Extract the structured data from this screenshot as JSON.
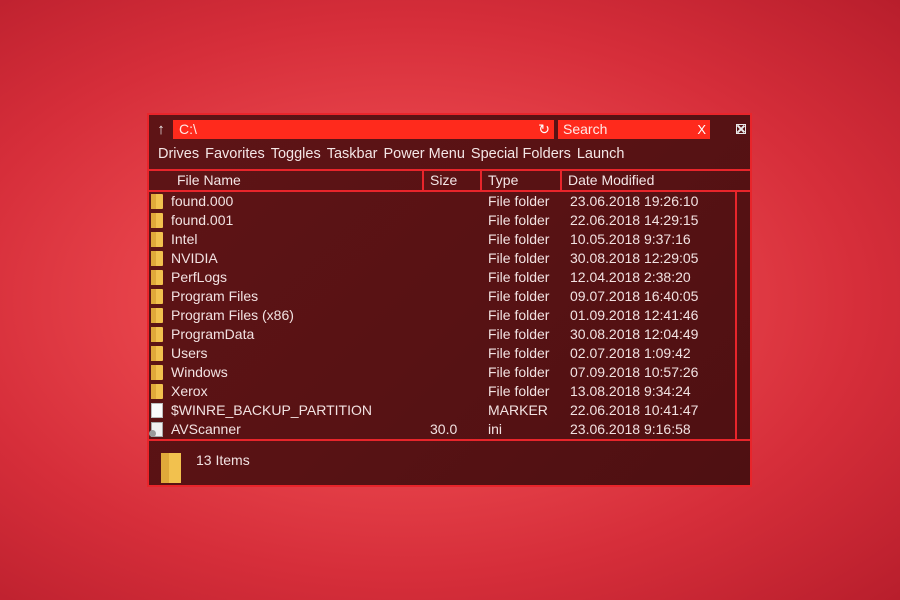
{
  "toolbar": {
    "up_icon": "arrow-up-icon",
    "address_value": "C:\\",
    "refresh_icon": "refresh-icon",
    "search_value": "Search",
    "search_clear": "X",
    "close_icon": "close-box-icon"
  },
  "menu": {
    "items": [
      "Drives",
      "Favorites",
      "Toggles",
      "Taskbar",
      "Power Menu",
      "Special Folders",
      "Launch"
    ]
  },
  "columns": {
    "name": "File Name",
    "size": "Size",
    "type": "Type",
    "date": "Date Modified"
  },
  "files": [
    {
      "icon": "folder-icon",
      "name": "found.000",
      "size": "",
      "type": "File folder",
      "date": "23.06.2018 19:26:10"
    },
    {
      "icon": "folder-icon",
      "name": "found.001",
      "size": "",
      "type": "File folder",
      "date": "22.06.2018 14:29:15"
    },
    {
      "icon": "folder-icon",
      "name": "Intel",
      "size": "",
      "type": "File folder",
      "date": "10.05.2018 9:37:16"
    },
    {
      "icon": "folder-icon",
      "name": "NVIDIA",
      "size": "",
      "type": "File folder",
      "date": "30.08.2018 12:29:05"
    },
    {
      "icon": "folder-icon",
      "name": "PerfLogs",
      "size": "",
      "type": "File folder",
      "date": "12.04.2018 2:38:20"
    },
    {
      "icon": "folder-icon",
      "name": "Program Files",
      "size": "",
      "type": "File folder",
      "date": "09.07.2018 16:40:05"
    },
    {
      "icon": "folder-icon",
      "name": "Program Files (x86)",
      "size": "",
      "type": "File folder",
      "date": "01.09.2018 12:41:46"
    },
    {
      "icon": "folder-icon",
      "name": "ProgramData",
      "size": "",
      "type": "File folder",
      "date": "30.08.2018 12:04:49"
    },
    {
      "icon": "folder-icon",
      "name": "Users",
      "size": "",
      "type": "File folder",
      "date": "02.07.2018 1:09:42"
    },
    {
      "icon": "folder-icon",
      "name": "Windows",
      "size": "",
      "type": "File folder",
      "date": "07.09.2018 10:57:26"
    },
    {
      "icon": "folder-icon",
      "name": "Xerox",
      "size": "",
      "type": "File folder",
      "date": "13.08.2018 9:34:24"
    },
    {
      "icon": "file-icon",
      "name": "$WINRE_BACKUP_PARTITION",
      "size": "",
      "type": "MARKER",
      "date": "22.06.2018 10:41:47"
    },
    {
      "icon": "ini-file-icon",
      "name": "AVScanner",
      "size": "30.0",
      "type": "ini",
      "date": "23.06.2018 9:16:58"
    }
  ],
  "status": {
    "icon": "folder-icon",
    "count_text": "13 Items"
  },
  "colors": {
    "accent": "#e8252b",
    "address_bg": "#ff2a1c",
    "window_bg": "#5a1315",
    "folder": "#f2c14e"
  }
}
